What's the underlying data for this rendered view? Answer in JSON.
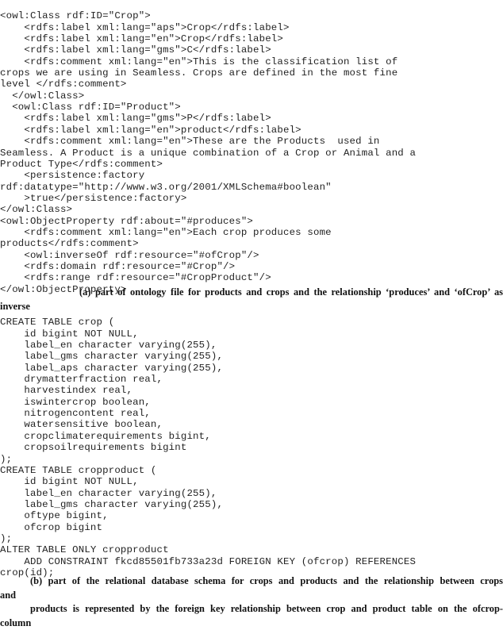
{
  "document": {
    "background_color": "#ffffff",
    "text_color": "#232323",
    "figure_parts": [
      "a",
      "b"
    ]
  },
  "ontology_listing": {
    "name": "ontology-file-excerpt",
    "language": "owl-rdf-xml",
    "lines": [
      "<owl:Class rdf:ID=\"Crop\">",
      "    <rdfs:label xml:lang=\"aps\">Crop</rdfs:label>",
      "    <rdfs:label xml:lang=\"en\">Crop</rdfs:label>",
      "    <rdfs:label xml:lang=\"gms\">C</rdfs:label>",
      "    <rdfs:comment xml:lang=\"en\">This is the classification list of",
      "crops we are using in Seamless. Crops are defined in the most fine",
      "level </rdfs:comment>",
      "  </owl:Class>",
      "  <owl:Class rdf:ID=\"Product\">",
      "    <rdfs:label xml:lang=\"gms\">P</rdfs:label>",
      "    <rdfs:label xml:lang=\"en\">product</rdfs:label>",
      "    <rdfs:comment xml:lang=\"en\">These are the Products  used in",
      "Seamless. A Product is a unique combination of a Crop or Animal and a",
      "Product Type</rdfs:comment>",
      "    <persistence:factory",
      "rdf:datatype=\"http://www.w3.org/2001/XMLSchema#boolean\"",
      "    >true</persistence:factory>",
      "</owl:Class>",
      "<owl:ObjectProperty rdf:about=\"#produces\">",
      "    <rdfs:comment xml:lang=\"en\">Each crop produces some",
      "products</rdfs:comment>",
      "    <owl:inverseOf rdf:resource=\"#ofCrop\"/>",
      "    <rdfs:domain rdf:resource=\"#Crop\"/>",
      "    <rdfs:range rdf:resource=\"#CropProduct\"/>",
      "</owl:ObjectProperty>"
    ]
  },
  "caption_a": {
    "label": "(a)",
    "text": "(a) part of ontology file for products and crops and the relationship ‘produces’ and ‘ofCrop’ as inverse"
  },
  "sql_listing": {
    "name": "relational-schema-excerpt",
    "language": "sql",
    "lines": [
      "CREATE TABLE crop (",
      "    id bigint NOT NULL,",
      "    label_en character varying(255),",
      "    label_gms character varying(255),",
      "    label_aps character varying(255),",
      "    drymatterfraction real,",
      "    harvestindex real,",
      "    iswintercrop boolean,",
      "    nitrogencontent real,",
      "    watersensitive boolean,",
      "    cropclimaterequirements bigint,",
      "    cropsoilrequirements bigint",
      ");",
      "CREATE TABLE cropproduct (",
      "    id bigint NOT NULL,",
      "    label_en character varying(255),",
      "    label_gms character varying(255),",
      "    oftype bigint,",
      "    ofcrop bigint",
      ");",
      "ALTER TABLE ONLY cropproduct",
      "    ADD CONSTRAINT fkcd85501fb733a23d FOREIGN KEY (ofcrop) REFERENCES",
      "crop(id);"
    ]
  },
  "caption_b": {
    "label": "(b)",
    "line1": "(b) part of the relational database schema for crops and products and the relationship between crops and",
    "line2": "products is represented by the foreign key relationship between crop and product table on the ofcrop-column"
  }
}
